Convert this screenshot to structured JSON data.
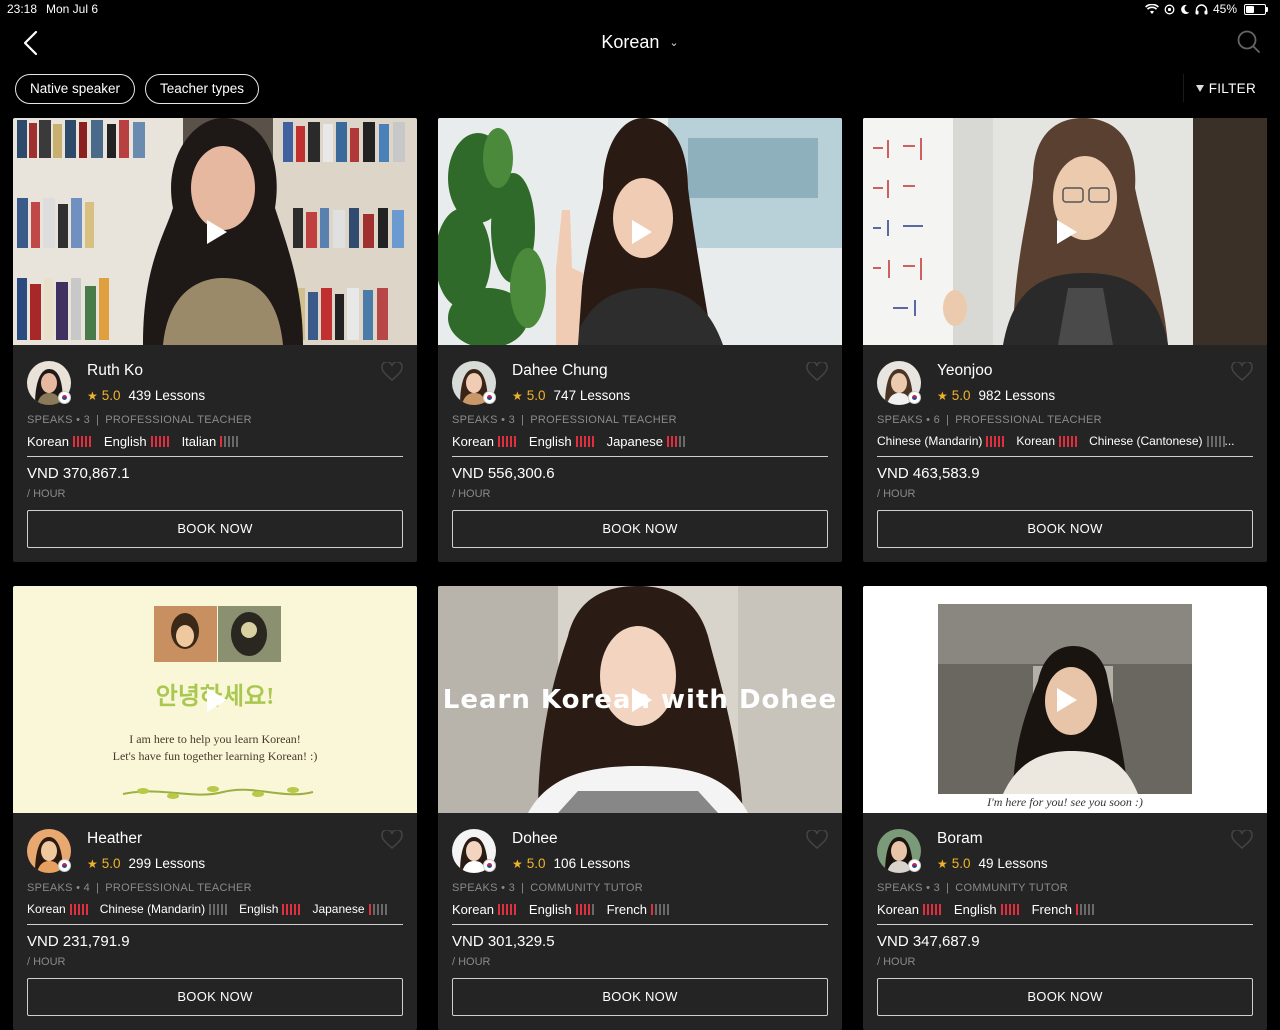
{
  "status_bar": {
    "time": "23:18",
    "date": "Mon Jul 6",
    "battery": "45%"
  },
  "nav": {
    "title": "Korean"
  },
  "filters": {
    "chip1": "Native speaker",
    "chip2": "Teacher types",
    "filter_label": "FILTER"
  },
  "cards": [
    {
      "name": "Ruth Ko",
      "rating": "5.0",
      "lessons": "439 Lessons",
      "speaks": "SPEAKS • 3",
      "type": "PROFESSIONAL TEACHER",
      "languages": [
        {
          "name": "Korean",
          "level": 5
        },
        {
          "name": "English",
          "level": 5
        },
        {
          "name": "Italian",
          "level": 1
        }
      ],
      "price": "VND 370,867.1",
      "unit": "/ HOUR",
      "book": "BOOK NOW"
    },
    {
      "name": "Dahee Chung",
      "rating": "5.0",
      "lessons": "747 Lessons",
      "speaks": "SPEAKS • 3",
      "type": "PROFESSIONAL TEACHER",
      "languages": [
        {
          "name": "Korean",
          "level": 5
        },
        {
          "name": "English",
          "level": 5
        },
        {
          "name": "Japanese",
          "level": 3
        }
      ],
      "price": "VND 556,300.6",
      "unit": "/ HOUR",
      "book": "BOOK NOW"
    },
    {
      "name": "Yeonjoo",
      "rating": "5.0",
      "lessons": "982 Lessons",
      "speaks": "SPEAKS • 6",
      "type": "PROFESSIONAL TEACHER",
      "languages": [
        {
          "name": "Chinese (Mandarin)",
          "level": 5
        },
        {
          "name": "Korean",
          "level": 5
        },
        {
          "name": "Chinese (Cantonese)",
          "level": 0
        }
      ],
      "price": "VND 463,583.9",
      "unit": "/ HOUR",
      "book": "BOOK NOW"
    },
    {
      "name": "Heather",
      "rating": "5.0",
      "lessons": "299 Lessons",
      "speaks": "SPEAKS • 4",
      "type": "PROFESSIONAL TEACHER",
      "languages": [
        {
          "name": "Korean",
          "level": 5
        },
        {
          "name": "Chinese (Mandarin)",
          "level": 0
        },
        {
          "name": "English",
          "level": 5
        },
        {
          "name": "Japanese",
          "level": 1
        }
      ],
      "price": "VND 231,791.9",
      "unit": "/ HOUR",
      "book": "BOOK NOW",
      "video_text": {
        "greeting": "안녕하세요!",
        "line1": "I am here to help you learn Korean!",
        "line2": "Let's have fun together learning Korean! :)"
      }
    },
    {
      "name": "Dohee",
      "rating": "5.0",
      "lessons": "106 Lessons",
      "speaks": "SPEAKS • 3",
      "type": "COMMUNITY TUTOR",
      "languages": [
        {
          "name": "Korean",
          "level": 5
        },
        {
          "name": "English",
          "level": 4
        },
        {
          "name": "French",
          "level": 1
        }
      ],
      "price": "VND 301,329.5",
      "unit": "/ HOUR",
      "book": "BOOK NOW",
      "video_text": {
        "caption": "Learn Korean with Dohee"
      }
    },
    {
      "name": "Boram",
      "rating": "5.0",
      "lessons": "49 Lessons",
      "speaks": "SPEAKS • 3",
      "type": "COMMUNITY TUTOR",
      "languages": [
        {
          "name": "Korean",
          "level": 5
        },
        {
          "name": "English",
          "level": 5
        },
        {
          "name": "French",
          "level": 1
        }
      ],
      "price": "VND 347,687.9",
      "unit": "/ HOUR",
      "book": "BOOK NOW",
      "video_text": {
        "caption": "I'm here for you! see you soon :)"
      }
    }
  ],
  "colors": {
    "accent": "#e0303f",
    "star": "#f0b429",
    "card_bg": "#242424"
  }
}
